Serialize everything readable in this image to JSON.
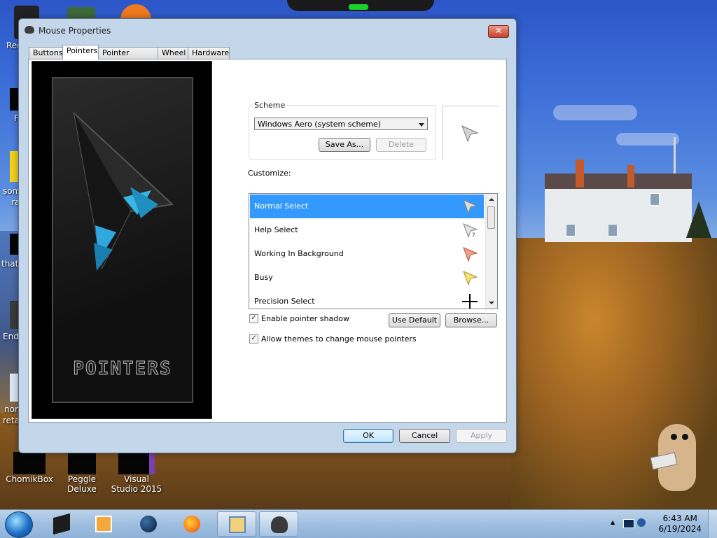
{
  "desktop": {
    "icons": [
      {
        "label": "Rec"
      },
      {
        "label": "F"
      },
      {
        "label": "som"
      },
      {
        "label": "ra"
      },
      {
        "label": "that"
      },
      {
        "label": "End"
      },
      {
        "label": "nor"
      },
      {
        "label": "reta"
      },
      {
        "label": "ChomikBox"
      },
      {
        "label": "Peggle Deluxe"
      },
      {
        "label": "Visual Studio 2015"
      }
    ]
  },
  "window": {
    "title": "Mouse Properties",
    "close_label": "✕",
    "tabs": [
      {
        "label": "Buttons"
      },
      {
        "label": "Pointers",
        "active": true
      },
      {
        "label": "Pointer Options"
      },
      {
        "label": "Wheel"
      },
      {
        "label": "Hardware"
      }
    ],
    "art_label": "POINTERS",
    "scheme": {
      "label": "Scheme",
      "selected": "Windows Aero (system scheme)",
      "save_as": "Save As...",
      "delete": "Delete"
    },
    "customize_label": "Customize:",
    "cursors": [
      {
        "label": "Normal Select",
        "icon": "arrow-cursor-icon",
        "color": "#c8c8c8",
        "selected": true
      },
      {
        "label": "Help Select",
        "icon": "help-cursor-icon",
        "color": "#c8c8c8"
      },
      {
        "label": "Working In Background",
        "icon": "working-cursor-icon",
        "color": "#f3a08a"
      },
      {
        "label": "Busy",
        "icon": "busy-cursor-icon",
        "color": "#f6e27a"
      },
      {
        "label": "Precision Select",
        "icon": "crosshair-cursor-icon",
        "color": "#000000"
      }
    ],
    "enable_shadow": {
      "label": "Enable pointer shadow",
      "checked": true
    },
    "use_default": "Use Default",
    "browse": "Browse...",
    "allow_themes": {
      "label": "Allow themes to change mouse pointers",
      "checked": true
    },
    "buttons": {
      "ok": "OK",
      "cancel": "Cancel",
      "apply": "Apply"
    }
  },
  "taskbar": {
    "time": "6:43 AM",
    "date": "6/19/2024",
    "tray_arrow": "▲"
  },
  "colors": {
    "selection": "#3399ff",
    "window_frame": "#c4d6ea"
  }
}
